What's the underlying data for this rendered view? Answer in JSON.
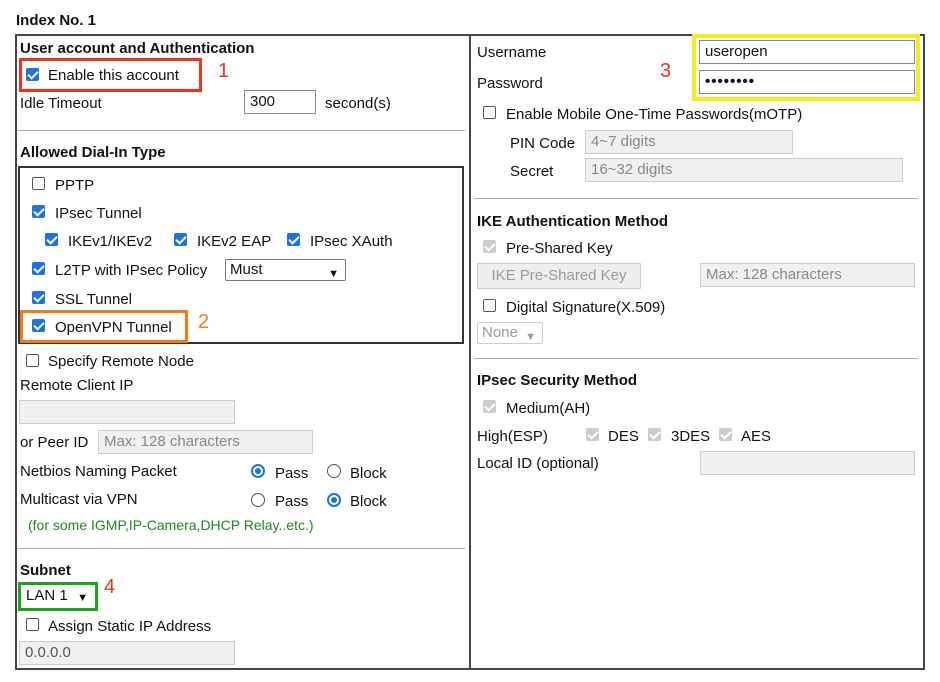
{
  "header": {
    "title": "Index No. 1"
  },
  "account": {
    "section_title": "User account and Authentication",
    "enable_label": "Enable this account",
    "idle_label": "Idle Timeout",
    "idle_value": "300",
    "idle_unit": "second(s)"
  },
  "dialin": {
    "section_title": "Allowed Dial-In Type",
    "pptp": "PPTP",
    "ipsec": "IPsec Tunnel",
    "ikev1": "IKEv1/IKEv2",
    "ikev2eap": "IKEv2 EAP",
    "xauth": "IPsec XAuth",
    "l2tp": "L2TP with IPsec Policy",
    "l2tp_policy": "Must",
    "ssl": "SSL Tunnel",
    "openvpn": "OpenVPN Tunnel"
  },
  "remote": {
    "specify_label": "Specify Remote Node",
    "client_ip_label": "Remote Client IP",
    "peer_id_label": "or Peer ID",
    "peer_id_placeholder": "Max: 128 characters",
    "netbios_label": "Netbios Naming Packet",
    "multicast_label": "Multicast via VPN",
    "pass": "Pass",
    "block": "Block",
    "note": "(for some IGMP,IP-Camera,DHCP Relay..etc.)"
  },
  "subnet": {
    "title": "Subnet",
    "value": "LAN 1",
    "assign_label": "Assign Static IP Address",
    "ip_value": "0.0.0.0"
  },
  "credentials": {
    "username_label": "Username",
    "username_value": "useropen",
    "password_label": "Password",
    "password_value": "••••••••",
    "motp_label": "Enable Mobile One-Time Passwords(mOTP)",
    "pin_label": "PIN Code",
    "pin_placeholder": "4~7 digits",
    "secret_label": "Secret",
    "secret_placeholder": "16~32 digits"
  },
  "ike": {
    "title": "IKE Authentication Method",
    "psk_label": "Pre-Shared Key",
    "psk_button": "IKE Pre-Shared Key",
    "psk_placeholder": "Max: 128 characters",
    "digsig_label": "Digital Signature(X.509)",
    "digsig_select": "None"
  },
  "ipsec_sec": {
    "title": "IPsec Security Method",
    "medium_label": "Medium(AH)",
    "high_label": "High(ESP)",
    "des": "DES",
    "3des": "3DES",
    "aes": "AES",
    "local_id_label": "Local ID (optional)"
  },
  "callouts": {
    "n1": "1",
    "n2": "2",
    "n3": "3",
    "n4": "4"
  },
  "colors": {
    "red": "#e8341c",
    "orange": "#f07b1e",
    "yellow": "#f5ec1a",
    "green": "#1aa51a",
    "accent": "#1a73e8"
  }
}
